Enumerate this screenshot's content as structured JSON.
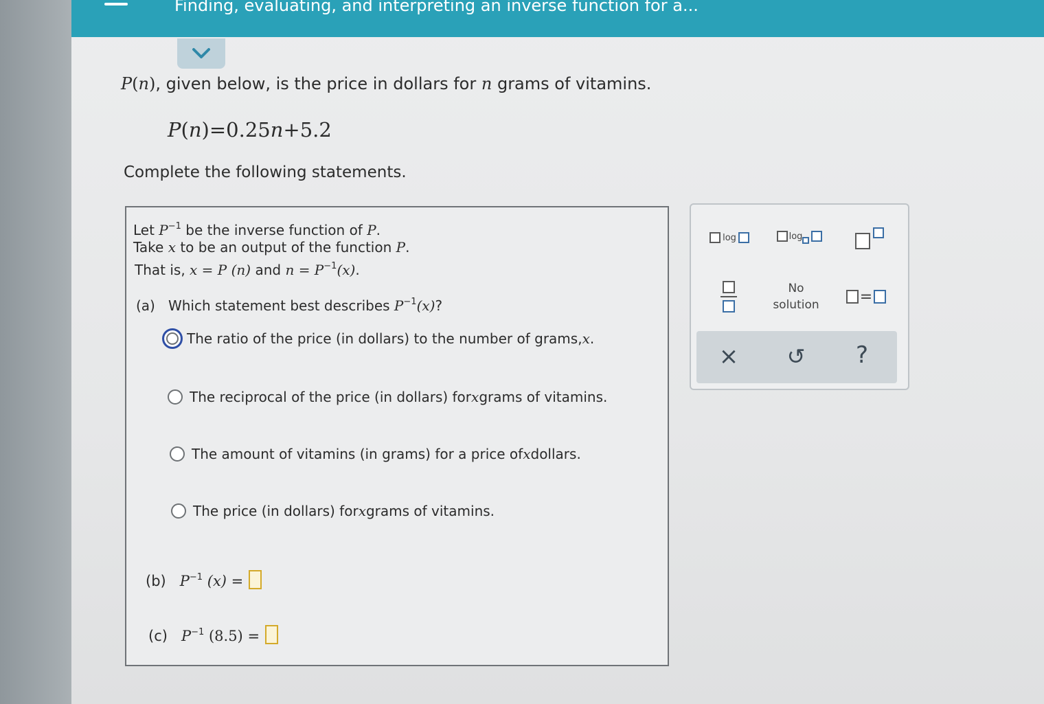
{
  "header": {
    "title": "Finding, evaluating, and interpreting an inverse function for a..."
  },
  "intro": {
    "function_name": "P",
    "variable": "n",
    "text_middle": ", given below, is the price in dollars for ",
    "text_end": " grams of vitamins."
  },
  "formula": {
    "lhs": "P",
    "var": "n",
    "rhs": "=0.25",
    "rhs_var": "n",
    "rhs_end": "+5.2"
  },
  "instruction": "Complete the following statements.",
  "question": {
    "line1_a": "Let ",
    "line1_fn": "P",
    "line1_sup": "−1",
    "line1_b": " be the inverse function of ",
    "line1_c": "P",
    "line1_d": ".",
    "line2_a": "Take ",
    "line2_x": "x",
    "line2_b": " to be an output of the function ",
    "line2_c": "P",
    "line2_d": ".",
    "line3_a": "That is, ",
    "line3_expr1": "x = P (n)",
    "line3_and": " and ",
    "line3_expr2": "n = P",
    "line3_sup": "−1",
    "line3_expr3": "(x)",
    "line3_end": ".",
    "part_a_label": "(a)",
    "part_a_text": "Which statement best describes ",
    "part_a_fn": "P",
    "part_a_sup": "−1",
    "part_a_arg": "(x)",
    "part_a_end": "?",
    "options": [
      {
        "pre": "The ratio of the price (in dollars) to the number of grams, ",
        "var": "x",
        "post": ".",
        "selected": true
      },
      {
        "pre": "The reciprocal of the price (in dollars) for ",
        "var": "x",
        "post": " grams of vitamins.",
        "selected": false
      },
      {
        "pre": "The amount of vitamins (in grams) for a price of ",
        "var": "x",
        "post": " dollars.",
        "selected": false
      },
      {
        "pre": "The price (in dollars) for ",
        "var": "x",
        "post": " grams of vitamins.",
        "selected": false
      }
    ],
    "part_b_label": "(b)",
    "part_b_fn": "P",
    "part_b_sup": "−1",
    "part_b_arg": "(x)",
    "part_b_eq": "=",
    "part_c_label": "(c)",
    "part_c_fn": "P",
    "part_c_sup": "−1",
    "part_c_arg": "(8.5)",
    "part_c_eq": "="
  },
  "palette": {
    "log_label": "log",
    "log_base_label": "log",
    "no_solution_line1": "No",
    "no_solution_line2": "solution",
    "equals_label": "=",
    "clear_icon": "×",
    "undo_icon": "↺",
    "help_icon": "?"
  }
}
